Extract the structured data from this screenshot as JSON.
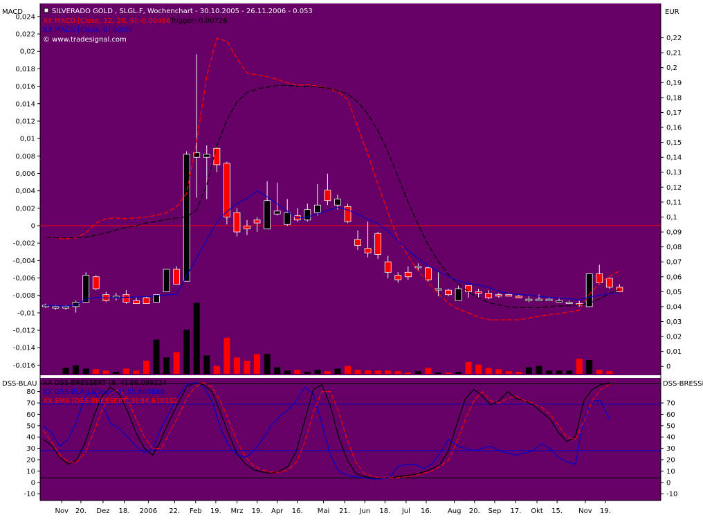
{
  "header": {
    "title": "SILVERADO GOLD , SLGL.F, Wochenchart - 30.10.2005 - 26.11.2006 - 0.053",
    "macd_line": "XX MACD [Close, 12, 26, 9]:-0.00486",
    "trigger_line": "Trigger:-0.00726",
    "macd_dkb_line": "XX MACD [Close, 0] 0,009",
    "copyright": "© www.tradesignal.com",
    "left_axis_label": "MACD",
    "right_axis_label": "EUR"
  },
  "lower_header": {
    "left_axis_label": "DSS-BLAU",
    "right_axis_label": "DSS-BRESSI",
    "line1": "XX DSS-BRESSERT [8, 4]:86.099224",
    "line2": "XX DSS-BLAU [Close, 5]:55.860886",
    "line3": "XX SMA [DSS-BRESSERT, 3]:84.610182"
  },
  "colors": {
    "panel_bg": "#660066",
    "up_candle": "#000000",
    "down_candle": "#ff0000",
    "macd_line": "#ff0000",
    "trigger_line": "#000000",
    "blue_line": "#0000cc",
    "zero_line": "#ff0000"
  },
  "chart_data": [
    {
      "type": "candlestick",
      "title": "SILVERADO GOLD , SLGL.F, Wochenchart - 30.10.2005 - 26.11.2006 - 0.053",
      "ylabel": "EUR",
      "ylim": [
        -0.005,
        0.23
      ],
      "right_ticks": [
        "0",
        "0,01",
        "0,02",
        "0,03",
        "0,04",
        "0,05",
        "0,06",
        "0,07",
        "0,08",
        "0,09",
        "0,1",
        "0,11",
        "0,12",
        "0,13",
        "0,14",
        "0,15",
        "0,16",
        "0,17",
        "0,18",
        "0,19",
        "0,2",
        "0,21",
        "0,22"
      ],
      "right_tick_values": [
        0,
        0.01,
        0.02,
        0.03,
        0.04,
        0.05,
        0.06,
        0.07,
        0.08,
        0.09,
        0.1,
        0.11,
        0.12,
        0.13,
        0.14,
        0.15,
        0.16,
        0.17,
        0.18,
        0.19,
        0.2,
        0.21,
        0.22
      ],
      "ohlc": [
        [
          0.04,
          0.041,
          0.039,
          0.042
        ],
        [
          0.039,
          0.04,
          0.038,
          0.041
        ],
        [
          0.039,
          0.04,
          0.038,
          0.041
        ],
        [
          0.04,
          0.043,
          0.036,
          0.044
        ],
        [
          0.043,
          0.061,
          0.043,
          0.063
        ],
        [
          0.06,
          0.052,
          0.051,
          0.061
        ],
        [
          0.048,
          0.044,
          0.043,
          0.05
        ],
        [
          0.047,
          0.047,
          0.044,
          0.049
        ],
        [
          0.048,
          0.043,
          0.042,
          0.051
        ],
        [
          0.044,
          0.042,
          0.042,
          0.046
        ],
        [
          0.046,
          0.042,
          0.042,
          0.047
        ],
        [
          0.043,
          0.048,
          0.043,
          0.048
        ],
        [
          0.05,
          0.065,
          0.05,
          0.065
        ],
        [
          0.065,
          0.055,
          0.055,
          0.067
        ],
        [
          0.057,
          0.142,
          0.057,
          0.144
        ],
        [
          0.14,
          0.143,
          0.113,
          0.209
        ],
        [
          0.14,
          0.142,
          0.112,
          0.148
        ],
        [
          0.146,
          0.135,
          0.13,
          0.147
        ],
        [
          0.136,
          0.1,
          0.095,
          0.137
        ],
        [
          0.103,
          0.09,
          0.087,
          0.106
        ],
        [
          0.094,
          0.092,
          0.088,
          0.098
        ],
        [
          0.098,
          0.096,
          0.09,
          0.1
        ],
        [
          0.092,
          0.111,
          0.092,
          0.124
        ],
        [
          0.102,
          0.104,
          0.101,
          0.123
        ],
        [
          0.095,
          0.103,
          0.094,
          0.112
        ],
        [
          0.101,
          0.098,
          0.097,
          0.106
        ],
        [
          0.098,
          0.105,
          0.097,
          0.109
        ],
        [
          0.103,
          0.108,
          0.101,
          0.122
        ],
        [
          0.118,
          0.111,
          0.108,
          0.129
        ],
        [
          0.108,
          0.112,
          0.105,
          0.115
        ],
        [
          0.107,
          0.097,
          0.096,
          0.109
        ],
        [
          0.085,
          0.081,
          0.078,
          0.091
        ],
        [
          0.079,
          0.076,
          0.073,
          0.097
        ],
        [
          0.089,
          0.075,
          0.072,
          0.09
        ],
        [
          0.07,
          0.063,
          0.059,
          0.074
        ],
        [
          0.061,
          0.058,
          0.056,
          0.063
        ],
        [
          0.063,
          0.06,
          0.058,
          0.067
        ],
        [
          0.066,
          0.067,
          0.064,
          0.069
        ],
        [
          0.066,
          0.058,
          0.057,
          0.067
        ],
        [
          0.052,
          0.052,
          0.047,
          0.063
        ],
        [
          0.051,
          0.048,
          0.047,
          0.052
        ],
        [
          0.044,
          0.052,
          0.044,
          0.054
        ],
        [
          0.054,
          0.05,
          0.046,
          0.054
        ],
        [
          0.05,
          0.049,
          0.046,
          0.052
        ],
        [
          0.049,
          0.046,
          0.045,
          0.051
        ],
        [
          0.048,
          0.047,
          0.046,
          0.049
        ],
        [
          0.048,
          0.047,
          0.047,
          0.049
        ],
        [
          0.047,
          0.046,
          0.046,
          0.048
        ],
        [
          0.044,
          0.045,
          0.043,
          0.047
        ],
        [
          0.044,
          0.045,
          0.044,
          0.048
        ],
        [
          0.044,
          0.045,
          0.044,
          0.046
        ],
        [
          0.044,
          0.044,
          0.043,
          0.046
        ],
        [
          0.043,
          0.043,
          0.042,
          0.044
        ],
        [
          0.042,
          0.041,
          0.04,
          0.044
        ],
        [
          0.04,
          0.062,
          0.04,
          0.062
        ],
        [
          0.062,
          0.056,
          0.055,
          0.068
        ],
        [
          0.059,
          0.053,
          0.052,
          0.059
        ],
        [
          0.053,
          0.05,
          0.05,
          0.055
        ]
      ],
      "volume": [
        0,
        0,
        0.9,
        1.3,
        0.8,
        0.7,
        0.5,
        0.3,
        0.8,
        0.5,
        2.0,
        5.2,
        2.5,
        3.3,
        6.7,
        10.8,
        2.8,
        1.2,
        5.5,
        2.5,
        2.0,
        3.0,
        3.0,
        1.0,
        0.5,
        0.6,
        0.3,
        0.6,
        0.4,
        0.8,
        1.2,
        0.6,
        0.5,
        0.5,
        0.5,
        0.4,
        0.2,
        0.4,
        0.9,
        0.2,
        0.2,
        0.3,
        1.8,
        1.4,
        0.9,
        0.7,
        0.4,
        0.3,
        1.0,
        1.2,
        0.5,
        0.5,
        0.5,
        2.3,
        2.1,
        0.6,
        0.4,
        0
      ],
      "macd": [
        -0.0013,
        -0.0014,
        -0.0015,
        -0.0014,
        -0.0008,
        0.0003,
        0.0008,
        0.0009,
        0.0008,
        0.0009,
        0.001,
        0.0012,
        0.0015,
        0.0022,
        0.0037,
        0.0097,
        0.0172,
        0.0215,
        0.0212,
        0.0192,
        0.0175,
        0.0173,
        0.0171,
        0.0168,
        0.0164,
        0.0161,
        0.0162,
        0.016,
        0.0158,
        0.0154,
        0.0145,
        0.0113,
        0.0082,
        0.0048,
        0.0015,
        -0.0015,
        -0.0035,
        -0.0052,
        -0.0065,
        -0.0078,
        -0.0089,
        -0.0096,
        -0.01,
        -0.0105,
        -0.0108,
        -0.0108,
        -0.0108,
        -0.0108,
        -0.0106,
        -0.0104,
        -0.0102,
        -0.0101,
        -0.0099,
        -0.0097,
        -0.0079,
        -0.0066,
        -0.0058,
        -0.0052
      ],
      "trigger": [
        -0.0013,
        -0.0014,
        -0.0014,
        -0.0014,
        -0.0013,
        -0.0011,
        -0.0008,
        -0.0005,
        -0.0002,
        0,
        0.0003,
        0.0005,
        0.0007,
        0.0009,
        0.001,
        0.0018,
        0.0047,
        0.0092,
        0.0121,
        0.0142,
        0.0153,
        0.0157,
        0.0159,
        0.0161,
        0.0161,
        0.016,
        0.016,
        0.0159,
        0.0158,
        0.0155,
        0.0151,
        0.0142,
        0.0128,
        0.0109,
        0.0085,
        0.0056,
        0.0027,
        0.0001,
        -0.0022,
        -0.0041,
        -0.0056,
        -0.0067,
        -0.0076,
        -0.0083,
        -0.0088,
        -0.0091,
        -0.0093,
        -0.0094,
        -0.0094,
        -0.0094,
        -0.0093,
        -0.0092,
        -0.0092,
        -0.0091,
        -0.0089,
        -0.0084,
        -0.0078,
        -0.0073
      ],
      "macd_ylim": [
        -0.017,
        0.0255
      ],
      "left_ticks": [
        "0,024",
        "0,022",
        "0,02",
        "0,018",
        "0,016",
        "0,014",
        "0,012",
        "0,01",
        "0,008",
        "0,006",
        "0,004",
        "0,002",
        "0",
        "-0,002",
        "-0,004",
        "-0,006",
        "-0,008",
        "-0,01",
        "-0,012",
        "-0,014",
        "-0,016"
      ],
      "left_tick_values": [
        0.024,
        0.022,
        0.02,
        0.018,
        0.016,
        0.014,
        0.012,
        0.01,
        0.008,
        0.006,
        0.004,
        0.002,
        0,
        -0.002,
        -0.004,
        -0.006,
        -0.008,
        -0.01,
        -0.012,
        -0.014,
        -0.016
      ]
    },
    {
      "type": "line",
      "ylim": [
        -16,
        92
      ],
      "left_ticks": [
        "80",
        "70",
        "60",
        "50",
        "40",
        "30",
        "20",
        "10",
        "0",
        "-10"
      ],
      "left_tick_values": [
        80,
        70,
        60,
        50,
        40,
        30,
        20,
        10,
        0,
        -10
      ],
      "right_ticks": [
        "70",
        "60",
        "50",
        "40",
        "30",
        "20",
        "10",
        "0",
        "-10"
      ],
      "right_tick_values": [
        70,
        60,
        50,
        40,
        30,
        20,
        10,
        0,
        -10
      ],
      "hlines": [
        87,
        69,
        28,
        4
      ],
      "series": [
        {
          "name": "DSS-BRESSERT [8, 4]",
          "values": [
            38,
            33,
            22,
            16,
            20,
            35,
            58,
            76,
            84,
            78,
            63,
            44,
            30,
            24,
            38,
            55,
            70,
            84,
            88,
            86,
            80,
            62,
            42,
            25,
            16,
            11,
            9,
            8,
            10,
            14,
            28,
            55,
            82,
            86,
            68,
            40,
            20,
            8,
            5,
            4,
            3,
            4,
            5,
            6,
            7,
            9,
            12,
            16,
            28,
            52,
            74,
            82,
            76,
            68,
            72,
            80,
            74,
            72,
            68,
            62,
            56,
            44,
            36,
            40,
            72,
            82,
            86,
            88
          ]
        },
        {
          "name": "DSS-BLAU [Close, 5]",
          "values": [
            50,
            44,
            32,
            38,
            54,
            76,
            80,
            70,
            52,
            48,
            40,
            32,
            26,
            30,
            48,
            62,
            76,
            86,
            88,
            84,
            72,
            48,
            32,
            24,
            22,
            28,
            38,
            50,
            58,
            64,
            72,
            84,
            78,
            52,
            24,
            10,
            6,
            5,
            4,
            3,
            3,
            4,
            14,
            16,
            16,
            12,
            16,
            26,
            38,
            32,
            30,
            28,
            30,
            32,
            28,
            26,
            24,
            26,
            28,
            34,
            30,
            22,
            18,
            16,
            56,
            72,
            72,
            56
          ]
        },
        {
          "name": "SMA [DSS-BRESSERT, 3]",
          "values": [
            46,
            36,
            24,
            18,
            18,
            26,
            44,
            64,
            78,
            82,
            74,
            56,
            40,
            30,
            30,
            44,
            58,
            74,
            84,
            88,
            84,
            72,
            54,
            36,
            22,
            14,
            11,
            9,
            9,
            11,
            18,
            36,
            62,
            80,
            80,
            62,
            38,
            18,
            8,
            5,
            4,
            4,
            4,
            5,
            6,
            8,
            10,
            14,
            20,
            36,
            56,
            72,
            80,
            72,
            70,
            74,
            76,
            72,
            70,
            66,
            60,
            50,
            40,
            38,
            54,
            72,
            82,
            86
          ]
        }
      ]
    }
  ],
  "x_axis": {
    "labels": [
      "Nov",
      "20.",
      "Dez",
      "18.",
      "2006",
      "22.",
      "Feb",
      "19.",
      "Mrz",
      "19.",
      "Apr",
      "16.",
      "Mai",
      "21.",
      "Jun",
      "18.",
      "Jul",
      "16.",
      "Aug",
      "20.",
      "Sep",
      "17.",
      "Okt",
      "15.",
      "Nov",
      "19."
    ],
    "label_index": [
      1.6,
      3.5,
      5.7,
      7.8,
      10.2,
      12.8,
      14.9,
      16.9,
      19.0,
      21.0,
      23.0,
      25.0,
      27.6,
      29.7,
      31.7,
      33.7,
      35.8,
      37.8,
      40.6,
      42.6,
      44.6,
      46.7,
      48.8,
      50.8,
      53.6,
      55.6
    ]
  }
}
